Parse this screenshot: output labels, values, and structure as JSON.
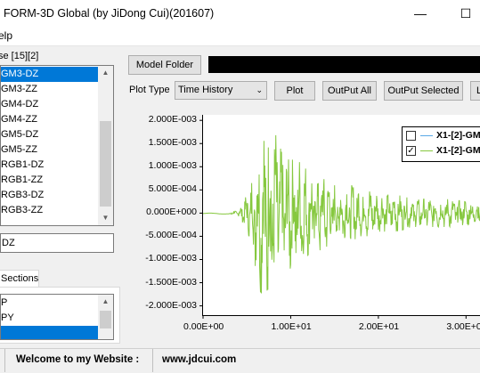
{
  "window": {
    "title": "FORM-3D Global (by JiDong Cui)(201607)",
    "minimize_glyph": "—",
    "maximize_glyph": "☐"
  },
  "menu": {
    "help_label": "elp"
  },
  "left_panel": {
    "group_label": "se [15][2]",
    "list_items": [
      "GM3-DZ",
      "GM3-ZZ",
      "GM4-DZ",
      "GM4-ZZ",
      "GM5-DZ",
      "GM5-ZZ",
      "RGB1-DZ",
      "RGB1-ZZ",
      "RGB3-DZ",
      "RGB3-ZZ"
    ],
    "selected_index": 0,
    "selected_field_value": "DZ",
    "tab_label": "Sections",
    "section_items": [
      "P",
      "PY",
      ""
    ],
    "section_selected_index": 2
  },
  "toolbar": {
    "model_folder_label": "Model Folder",
    "plot_type_label": "Plot Type",
    "plot_type_value": "Time History",
    "plot_button": "Plot",
    "output_all_button": "OutPut All",
    "output_selected_button": "OutPut Selected",
    "last_button": "L"
  },
  "chart_data": {
    "type": "line",
    "title": "",
    "xlabel": "",
    "ylabel": "",
    "xlim": [
      0,
      32
    ],
    "ylim": [
      -0.0022,
      0.0021
    ],
    "y_ticks": [
      "2.000E-003",
      "1.500E-003",
      "1.000E-003",
      "5.000E-004",
      "0.000E+000",
      "-5.000E-004",
      "-1.000E-003",
      "-1.500E-003",
      "-2.000E-003"
    ],
    "y_tick_values": [
      0.002,
      0.0015,
      0.001,
      0.0005,
      0,
      -0.0005,
      -0.001,
      -0.0015,
      -0.002
    ],
    "x_ticks": [
      "0.00E+00",
      "1.00E+01",
      "2.00E+01",
      "3.00E+01"
    ],
    "x_tick_values": [
      0,
      10,
      20,
      30
    ],
    "series": [
      {
        "name": "X1-[2]-GM",
        "color": "#5aa9e6",
        "checked": false,
        "visible": false
      },
      {
        "name": "X1-[2]-GM",
        "color": "#86c83f",
        "checked": true,
        "visible": true,
        "envelope": [
          [
            0,
            2e-05
          ],
          [
            3,
            2e-05
          ],
          [
            4,
            8e-05
          ],
          [
            4.5,
            0.0002
          ],
          [
            5,
            0.0004
          ],
          [
            5.5,
            0.0006
          ],
          [
            6,
            0.0012
          ],
          [
            6.5,
            0.0017
          ],
          [
            7,
            0.0018
          ],
          [
            7.5,
            0.0022
          ],
          [
            8,
            0.0018
          ],
          [
            8.5,
            0.0016
          ],
          [
            9,
            0.0013
          ],
          [
            10,
            0.0012
          ],
          [
            11,
            0.0011
          ],
          [
            12,
            0.0009
          ],
          [
            13,
            0.0008
          ],
          [
            14,
            0.0008
          ],
          [
            15,
            0.0006
          ],
          [
            16,
            0.0006
          ],
          [
            17,
            0.0006
          ],
          [
            18,
            0.0005
          ],
          [
            19,
            0.0005
          ],
          [
            20,
            0.0004
          ],
          [
            22,
            0.0004
          ],
          [
            24,
            0.0003
          ],
          [
            26,
            0.0003
          ],
          [
            28,
            0.0003
          ],
          [
            30,
            0.00025
          ],
          [
            32,
            0.00025
          ]
        ]
      }
    ],
    "legend": "top-right",
    "grid": false,
    "background": "#ffffff"
  },
  "status": {
    "welcome_text": "Welcome to my Website :",
    "website": "www.jdcui.com"
  }
}
